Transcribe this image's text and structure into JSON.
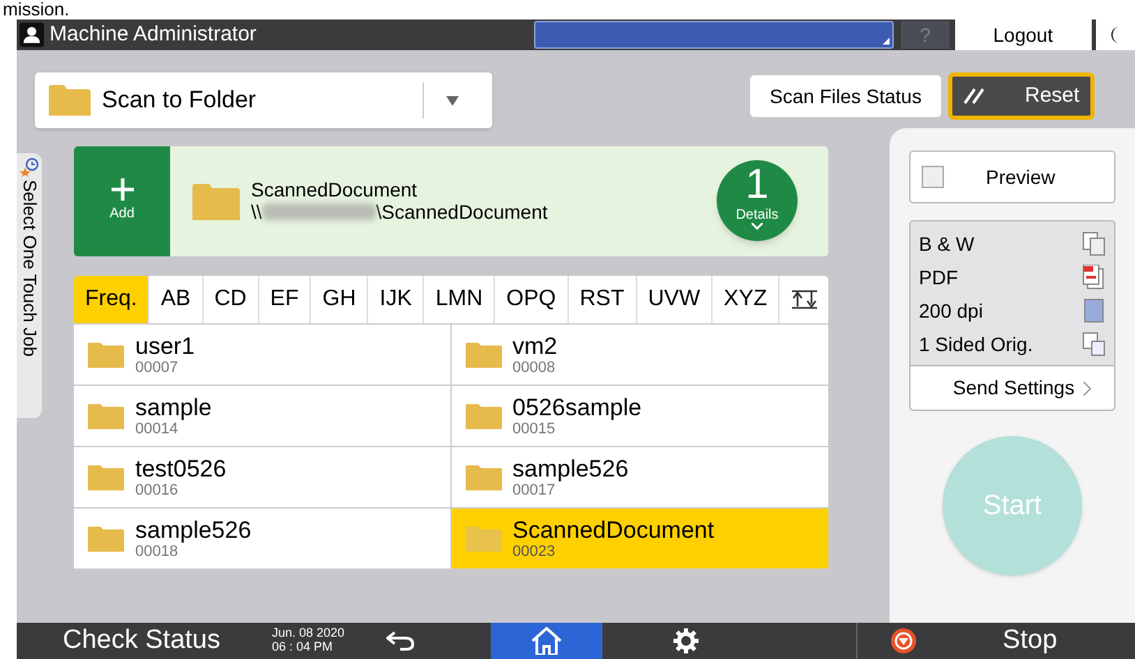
{
  "page_fragment": "mission.",
  "header": {
    "user": "Machine Administrator",
    "help": "?",
    "logout": "Logout"
  },
  "function_select": {
    "value": "Scan to Folder"
  },
  "scan_files_status": "Scan Files Status",
  "reset": "Reset",
  "side_tab": "Select One Touch Job",
  "add": "Add",
  "destination": {
    "name": "ScannedDocument",
    "path_start": "\\\\",
    "path_end": "\\ScannedDocument",
    "count": "1",
    "details": "Details"
  },
  "tabs": [
    {
      "label": "Freq.",
      "selected": true
    },
    {
      "label": "AB",
      "selected": false
    },
    {
      "label": "CD",
      "selected": false
    },
    {
      "label": "EF",
      "selected": false
    },
    {
      "label": "GH",
      "selected": false
    },
    {
      "label": "IJK",
      "selected": false
    },
    {
      "label": "LMN",
      "selected": false
    },
    {
      "label": "OPQ",
      "selected": false
    },
    {
      "label": "RST",
      "selected": false
    },
    {
      "label": "UVW",
      "selected": false
    },
    {
      "label": "XYZ",
      "selected": false
    }
  ],
  "entries": [
    {
      "name": "user1",
      "number": "00007",
      "selected": false
    },
    {
      "name": "vm2",
      "number": "00008",
      "selected": false
    },
    {
      "name": "sample",
      "number": "00014",
      "selected": false
    },
    {
      "name": "0526sample",
      "number": "00015",
      "selected": false
    },
    {
      "name": "test0526",
      "number": "00016",
      "selected": false
    },
    {
      "name": "sample526",
      "number": "00017",
      "selected": false
    },
    {
      "name": "sample526",
      "number": "00018",
      "selected": false
    },
    {
      "name": "ScannedDocument",
      "number": "00023",
      "selected": true
    }
  ],
  "preview": {
    "label": "Preview",
    "checked": false
  },
  "settings": [
    {
      "label": "B & W",
      "kind": "color"
    },
    {
      "label": "PDF",
      "kind": "pdf"
    },
    {
      "label": "200 dpi",
      "kind": "resolution"
    },
    {
      "label": "1 Sided Orig.",
      "kind": "sides"
    }
  ],
  "send_settings": "Send Settings",
  "start": {
    "label": "Start",
    "disabled": true
  },
  "status_bar": {
    "check_status": "Check Status",
    "date": "Jun. 08 2020",
    "time": "06 : 04 PM",
    "stop": "Stop"
  }
}
